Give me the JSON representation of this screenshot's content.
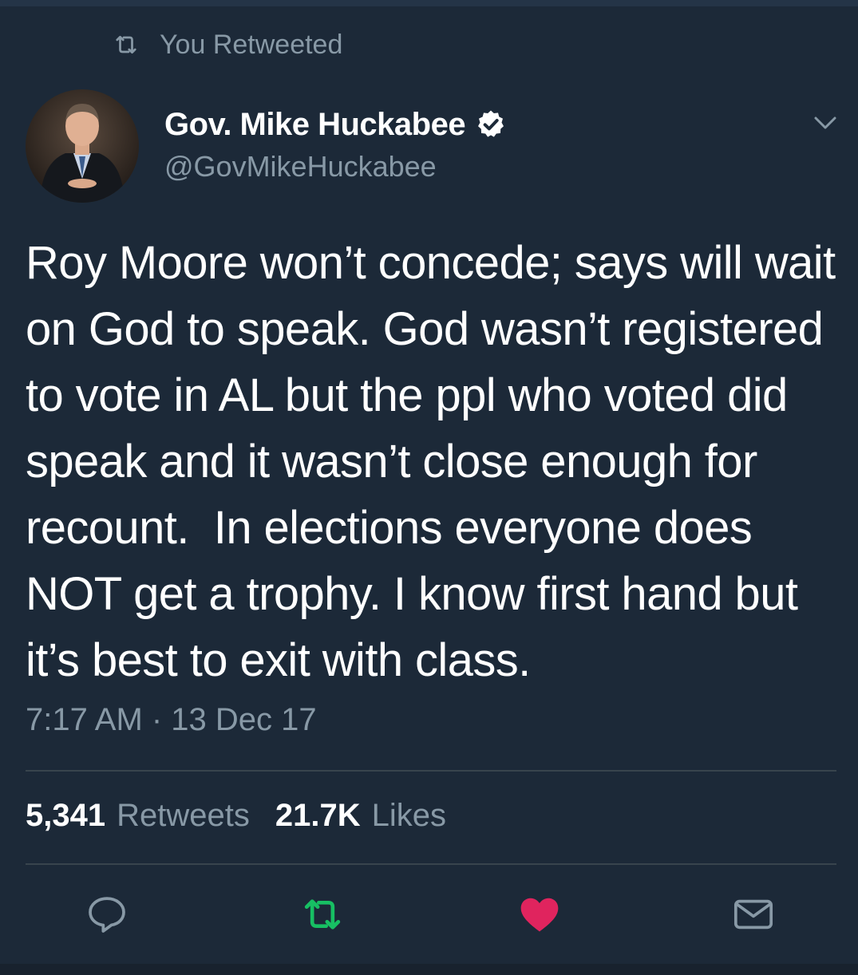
{
  "retweet_context": {
    "label": "You Retweeted",
    "icon": "retweet-icon"
  },
  "author": {
    "display_name": "Gov. Mike Huckabee",
    "handle": "@GovMikeHuckabee",
    "verified": true
  },
  "tweet": {
    "text": "Roy Moore won’t concede; says will wait on God to speak. God wasn’t registered to vote in AL but the ppl who voted did speak and it wasn’t close enough for recount.  In elections everyone does NOT get a trophy. I know first hand but it’s best to exit with class.",
    "timestamp": "7:17 AM · 13 Dec 17"
  },
  "stats": {
    "retweets_count": "5,341",
    "retweets_label": "Retweets",
    "likes_count": "21.7K",
    "likes_label": "Likes"
  },
  "actions": {
    "reply_icon": "reply-icon",
    "retweet_icon": "retweet-icon",
    "like_icon": "heart-icon",
    "dm_icon": "mail-icon"
  },
  "colors": {
    "background": "#1c2938",
    "secondary_text": "#8899a6",
    "retweet_active": "#17bf63",
    "like_active": "#e0245e"
  }
}
